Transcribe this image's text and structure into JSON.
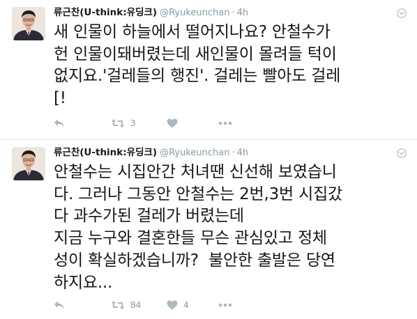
{
  "tweets": [
    {
      "author_name": "류근찬(U-think:유딩크)",
      "screen_name": "@Ryukeunchan",
      "time": "4h",
      "text": "새 인물이 하늘에서 떨어지나요? 안철수가\n헌 인물이돼버렸는데 새인물이 몰려들 턱이\n없지요.'걸레들의 행진'. 걸레는 빨아도 걸레\n[!",
      "retweet_count": "3",
      "like_count": ""
    },
    {
      "author_name": "류근찬(U-think:유딩크)",
      "screen_name": "@Ryukeunchan",
      "time": "4h",
      "text": "안철수는 시집안간 처녀땐 신선해 보였습니\n다. 그러나 그동안 안철수는 2번,3번 시집갔\n다 과수가된 걸레가 버렸는데\n지금 누구와 결혼한들 무슨 관심있고 정체\n성이 확실하겠습니까?  불안한 출발은 당연\n하지요...",
      "retweet_count": "84",
      "like_count": "4"
    }
  ],
  "icons": {
    "reply": "reply-icon",
    "retweet": "retweet-icon",
    "like": "heart-icon",
    "more": "more-icon",
    "caret": "chevron-down-icon"
  },
  "colors": {
    "text": "#14171a",
    "muted": "#8899a6",
    "icon": "#aab8c2",
    "divider": "#e1e8ed"
  }
}
